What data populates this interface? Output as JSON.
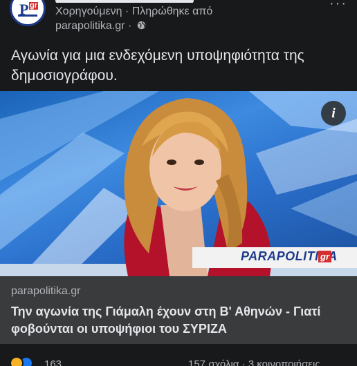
{
  "post": {
    "sponsored_line": "Χορηγούμενη · Πληρώθηκε από",
    "domain_line": "parapolitika.gr ·",
    "caption": "Αγωνία για μια ενδεχόμενη υποψηφιότητα της δημοσιογράφου."
  },
  "media": {
    "info_label": "i",
    "watermark_text": "PARAPOLITIKA",
    "watermark_suffix": "gr"
  },
  "link": {
    "domain": "parapolitika.gr",
    "title": "Την αγωνία της Γιάμαλη έχουν στη Β' Αθηνών - Γιατί φοβούνται οι υποψήφιοι του ΣΥΡΙΖΑ"
  },
  "footer": {
    "reaction_count": "163",
    "stats": "157 σχόλια · 3 κοινοποιήσεις"
  },
  "colors": {
    "background": "#18191a",
    "link_box": "#3a3b3c",
    "text_primary": "#e4e6eb",
    "text_secondary": "#b0b3b8",
    "brand_blue": "#1e3a8a",
    "brand_red": "#d32f2f"
  }
}
